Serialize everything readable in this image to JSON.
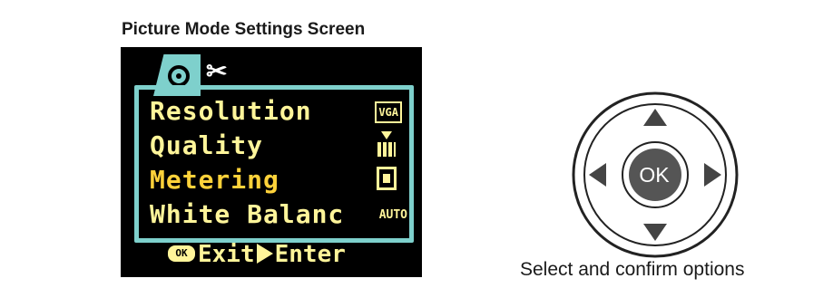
{
  "title": "Picture Mode Settings Screen",
  "lcd": {
    "tabs": [
      {
        "icon": "camera-icon"
      },
      {
        "icon": "setup-wrench-icon"
      }
    ],
    "menu": [
      {
        "label": "Resolution",
        "value_text": "VGA",
        "value_icon": "vga-resolution-icon",
        "selected": false
      },
      {
        "label": "Quality",
        "value_icon": "quality-fine-icon",
        "selected": false
      },
      {
        "label": "Metering",
        "value_icon": "center-metering-icon",
        "selected": true
      },
      {
        "label": "White Balanc",
        "value_text": "AUTO",
        "value_icon": "auto-wb-icon",
        "selected": false
      }
    ],
    "footer": {
      "ok_badge": "OK",
      "exit_label": "Exit",
      "enter_label": "Enter"
    }
  },
  "pad": {
    "center_label": "OK",
    "caption": "Select and confirm options"
  },
  "colors": {
    "lcd_accent": "#7ed0cc",
    "lcd_text": "#fff59a",
    "pad_center": "#555555"
  }
}
